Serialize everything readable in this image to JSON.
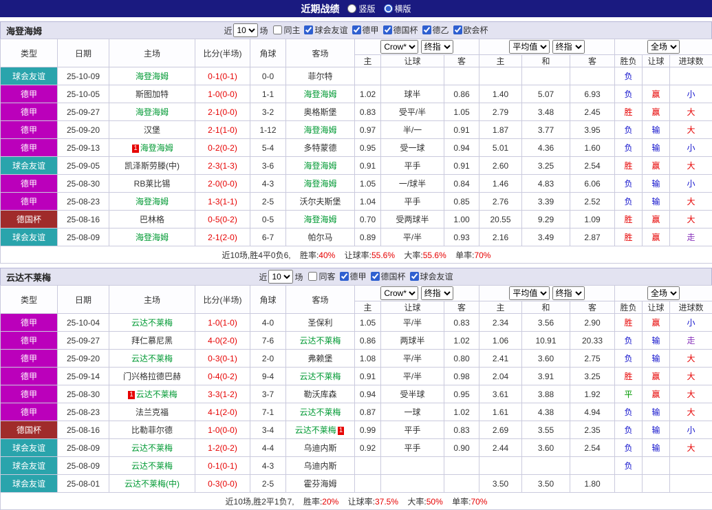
{
  "titlebar": {
    "title": "近期战绩",
    "radio_vertical": "竖版",
    "radio_horizontal": "横版",
    "selected_layout": "横版"
  },
  "filter_labels": {
    "near": "近",
    "count": "10",
    "games": "场"
  },
  "table_header": {
    "col_type": "类型",
    "col_date": "日期",
    "col_home": "主场",
    "col_score": "比分(半场)",
    "col_corner": "角球",
    "col_away": "客场",
    "odds_select1": "Crow*",
    "odds_select2": "终指",
    "avg_select1": "平均值",
    "avg_select2": "终指",
    "scope_select": "全场",
    "sub_home": "主",
    "sub_handicap": "让球",
    "sub_away": "客",
    "sub_draw": "和",
    "col_result": "胜负",
    "col_goals": "进球数"
  },
  "colors": {
    "navy": "#1a1a80",
    "type": {
      "球会友谊": "#2aa4ac",
      "德甲": "#bb00bb",
      "德国杯": "#a02b2b"
    },
    "result": {
      "胜": "#e60000",
      "赢": "#e60000",
      "大": "#e60000",
      "负": "#1111cc",
      "输": "#1111cc",
      "小": "#1111cc",
      "平": "#009900",
      "走": "#8833bb"
    },
    "score": "#e60000",
    "focal_team": "#009933"
  },
  "sections": [
    {
      "team": "海登海姆",
      "filters": [
        {
          "label": "同主",
          "checked": false
        },
        {
          "label": "球会友谊",
          "checked": true
        },
        {
          "label": "德甲",
          "checked": true
        },
        {
          "label": "德国杯",
          "checked": true
        },
        {
          "label": "德乙",
          "checked": true
        },
        {
          "label": "欧会杯",
          "checked": true
        }
      ],
      "rows": [
        {
          "type": "球会友谊",
          "date": "25-10-09",
          "home": "海登海姆",
          "home_focal": true,
          "score": "0-1(0-1)",
          "corner": "0-0",
          "away": "菲尔特",
          "away_focal": false,
          "odds": [
            "",
            "",
            ""
          ],
          "avg": [
            "",
            "",
            ""
          ],
          "result": "负",
          "handicap_result": "",
          "goals": ""
        },
        {
          "type": "德甲",
          "date": "25-10-05",
          "home": "斯图加特",
          "home_focal": false,
          "score": "1-0(0-0)",
          "corner": "1-1",
          "away": "海登海姆",
          "away_focal": true,
          "odds": [
            "1.02",
            "球半",
            "0.86"
          ],
          "avg": [
            "1.40",
            "5.07",
            "6.93"
          ],
          "result": "负",
          "handicap_result": "赢",
          "goals": "小"
        },
        {
          "type": "德甲",
          "date": "25-09-27",
          "home": "海登海姆",
          "home_focal": true,
          "score": "2-1(0-0)",
          "corner": "3-2",
          "away": "奥格斯堡",
          "away_focal": false,
          "odds": [
            "0.83",
            "受平/半",
            "1.05"
          ],
          "avg": [
            "2.79",
            "3.48",
            "2.45"
          ],
          "result": "胜",
          "handicap_result": "赢",
          "goals": "大"
        },
        {
          "type": "德甲",
          "date": "25-09-20",
          "home": "汉堡",
          "home_focal": false,
          "score": "2-1(1-0)",
          "corner": "1-12",
          "away": "海登海姆",
          "away_focal": true,
          "odds": [
            "0.97",
            "半/一",
            "0.91"
          ],
          "avg": [
            "1.87",
            "3.77",
            "3.95"
          ],
          "result": "负",
          "handicap_result": "输",
          "goals": "大"
        },
        {
          "type": "德甲",
          "date": "25-09-13",
          "home": "海登海姆",
          "home_focal": true,
          "home_card": "1",
          "score": "0-2(0-2)",
          "corner": "5-4",
          "away": "多特蒙德",
          "away_focal": false,
          "odds": [
            "0.95",
            "受一球",
            "0.94"
          ],
          "avg": [
            "5.01",
            "4.36",
            "1.60"
          ],
          "result": "负",
          "handicap_result": "输",
          "goals": "小"
        },
        {
          "type": "球会友谊",
          "date": "25-09-05",
          "home": "凯泽斯劳滕(中)",
          "home_focal": false,
          "score": "2-3(1-3)",
          "corner": "3-6",
          "away": "海登海姆",
          "away_focal": true,
          "odds": [
            "0.91",
            "平手",
            "0.91"
          ],
          "avg": [
            "2.60",
            "3.25",
            "2.54"
          ],
          "result": "胜",
          "handicap_result": "赢",
          "goals": "大"
        },
        {
          "type": "德甲",
          "date": "25-08-30",
          "home": "RB莱比锡",
          "home_focal": false,
          "score": "2-0(0-0)",
          "corner": "4-3",
          "away": "海登海姆",
          "away_focal": true,
          "odds": [
            "1.05",
            "一/球半",
            "0.84"
          ],
          "avg": [
            "1.46",
            "4.83",
            "6.06"
          ],
          "result": "负",
          "handicap_result": "输",
          "goals": "小"
        },
        {
          "type": "德甲",
          "date": "25-08-23",
          "home": "海登海姆",
          "home_focal": true,
          "score": "1-3(1-1)",
          "corner": "2-5",
          "away": "沃尔夫斯堡",
          "away_focal": false,
          "odds": [
            "1.04",
            "平手",
            "0.85"
          ],
          "avg": [
            "2.76",
            "3.39",
            "2.52"
          ],
          "result": "负",
          "handicap_result": "输",
          "goals": "大"
        },
        {
          "type": "德国杯",
          "date": "25-08-16",
          "home": "巴林格",
          "home_focal": false,
          "score": "0-5(0-2)",
          "corner": "0-5",
          "away": "海登海姆",
          "away_focal": true,
          "odds": [
            "0.70",
            "受两球半",
            "1.00"
          ],
          "avg": [
            "20.55",
            "9.29",
            "1.09"
          ],
          "result": "胜",
          "handicap_result": "赢",
          "goals": "大"
        },
        {
          "type": "球会友谊",
          "date": "25-08-09",
          "home": "海登海姆",
          "home_focal": true,
          "score": "2-1(2-0)",
          "corner": "6-7",
          "away": "帕尔马",
          "away_focal": false,
          "odds": [
            "0.89",
            "平/半",
            "0.93"
          ],
          "avg": [
            "2.16",
            "3.49",
            "2.87"
          ],
          "result": "胜",
          "handicap_result": "赢",
          "goals": "走"
        }
      ],
      "summary": {
        "prefix": "近10场,胜4平0负6,",
        "stats": [
          {
            "label": "胜率:",
            "value": "40%"
          },
          {
            "label": "让球率:",
            "value": "55.6%"
          },
          {
            "label": "大率:",
            "value": "55.6%"
          },
          {
            "label": "单率:",
            "value": "70%"
          }
        ]
      }
    },
    {
      "team": "云达不莱梅",
      "filters": [
        {
          "label": "同客",
          "checked": false
        },
        {
          "label": "德甲",
          "checked": true
        },
        {
          "label": "德国杯",
          "checked": true
        },
        {
          "label": "球会友谊",
          "checked": true
        }
      ],
      "rows": [
        {
          "type": "德甲",
          "date": "25-10-04",
          "home": "云达不莱梅",
          "home_focal": true,
          "score": "1-0(1-0)",
          "corner": "4-0",
          "away": "圣保利",
          "away_focal": false,
          "odds": [
            "1.05",
            "平/半",
            "0.83"
          ],
          "avg": [
            "2.34",
            "3.56",
            "2.90"
          ],
          "result": "胜",
          "handicap_result": "赢",
          "goals": "小"
        },
        {
          "type": "德甲",
          "date": "25-09-27",
          "home": "拜仁慕尼黑",
          "home_focal": false,
          "score": "4-0(2-0)",
          "corner": "7-6",
          "away": "云达不莱梅",
          "away_focal": true,
          "odds": [
            "0.86",
            "两球半",
            "1.02"
          ],
          "avg": [
            "1.06",
            "10.91",
            "20.33"
          ],
          "result": "负",
          "handicap_result": "输",
          "goals": "走"
        },
        {
          "type": "德甲",
          "date": "25-09-20",
          "home": "云达不莱梅",
          "home_focal": true,
          "score": "0-3(0-1)",
          "corner": "2-0",
          "away": "弗赖堡",
          "away_focal": false,
          "odds": [
            "1.08",
            "平/半",
            "0.80"
          ],
          "avg": [
            "2.41",
            "3.60",
            "2.75"
          ],
          "result": "负",
          "handicap_result": "输",
          "goals": "大"
        },
        {
          "type": "德甲",
          "date": "25-09-14",
          "home": "门兴格拉德巴赫",
          "home_focal": false,
          "score": "0-4(0-2)",
          "corner": "9-4",
          "away": "云达不莱梅",
          "away_focal": true,
          "odds": [
            "0.91",
            "平/半",
            "0.98"
          ],
          "avg": [
            "2.04",
            "3.91",
            "3.25"
          ],
          "result": "胜",
          "handicap_result": "赢",
          "goals": "大"
        },
        {
          "type": "德甲",
          "date": "25-08-30",
          "home": "云达不莱梅",
          "home_focal": true,
          "home_card": "1",
          "score": "3-3(1-2)",
          "corner": "3-7",
          "away": "勒沃库森",
          "away_focal": false,
          "odds": [
            "0.94",
            "受半球",
            "0.95"
          ],
          "avg": [
            "3.61",
            "3.88",
            "1.92"
          ],
          "result": "平",
          "handicap_result": "赢",
          "goals": "大"
        },
        {
          "type": "德甲",
          "date": "25-08-23",
          "home": "法兰克福",
          "home_focal": false,
          "score": "4-1(2-0)",
          "corner": "7-1",
          "away": "云达不莱梅",
          "away_focal": true,
          "odds": [
            "0.87",
            "一球",
            "1.02"
          ],
          "avg": [
            "1.61",
            "4.38",
            "4.94"
          ],
          "result": "负",
          "handicap_result": "输",
          "goals": "大"
        },
        {
          "type": "德国杯",
          "date": "25-08-16",
          "home": "比勒菲尔德",
          "home_focal": false,
          "score": "1-0(0-0)",
          "corner": "3-4",
          "away": "云达不莱梅",
          "away_focal": true,
          "away_card": "1",
          "odds": [
            "0.99",
            "平手",
            "0.83"
          ],
          "avg": [
            "2.69",
            "3.55",
            "2.35"
          ],
          "result": "负",
          "handicap_result": "输",
          "goals": "小"
        },
        {
          "type": "球会友谊",
          "date": "25-08-09",
          "home": "云达不莱梅",
          "home_focal": true,
          "score": "1-2(0-2)",
          "corner": "4-4",
          "away": "乌迪内斯",
          "away_focal": false,
          "odds": [
            "0.92",
            "平手",
            "0.90"
          ],
          "avg": [
            "2.44",
            "3.60",
            "2.54"
          ],
          "result": "负",
          "handicap_result": "输",
          "goals": "大"
        },
        {
          "type": "球会友谊",
          "date": "25-08-09",
          "home": "云达不莱梅",
          "home_focal": true,
          "score": "0-1(0-1)",
          "corner": "4-3",
          "away": "乌迪内斯",
          "away_focal": false,
          "odds": [
            "",
            "",
            ""
          ],
          "avg": [
            "",
            "",
            ""
          ],
          "result": "负",
          "handicap_result": "",
          "goals": ""
        },
        {
          "type": "球会友谊",
          "date": "25-08-01",
          "home": "云达不莱梅(中)",
          "home_focal": true,
          "score": "0-3(0-0)",
          "corner": "2-5",
          "away": "霍芬海姆",
          "away_focal": false,
          "odds": [
            "",
            "",
            ""
          ],
          "avg": [
            "3.50",
            "3.50",
            "1.80"
          ],
          "result": "",
          "handicap_result": "",
          "goals": ""
        }
      ],
      "summary": {
        "prefix": "近10场,胜2平1负7,",
        "stats": [
          {
            "label": "胜率:",
            "value": "20%"
          },
          {
            "label": "让球率:",
            "value": "37.5%"
          },
          {
            "label": "大率:",
            "value": "50%"
          },
          {
            "label": "单率:",
            "value": "70%"
          }
        ]
      }
    }
  ]
}
